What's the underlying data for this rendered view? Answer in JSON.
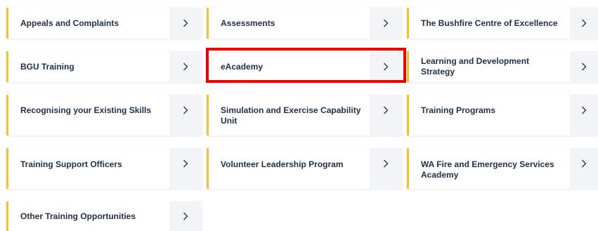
{
  "cards": [
    {
      "label": "Appeals and Complaints",
      "icon": "chevron-right-icon"
    },
    {
      "label": "Assessments",
      "icon": "chevron-right-icon"
    },
    {
      "label": "The Bushfire Centre of Excellence",
      "icon": "chevron-right-icon"
    },
    {
      "label": "BGU Training",
      "icon": "chevron-right-icon"
    },
    {
      "label": "eAcademy",
      "icon": "chevron-right-icon"
    },
    {
      "label": "Learning and Development Strategy",
      "icon": "chevron-right-icon"
    },
    {
      "label": "Recognising your Existing Skills",
      "icon": "chevron-right-icon"
    },
    {
      "label": "Simulation and Exercise Capability Unit",
      "icon": "chevron-right-icon"
    },
    {
      "label": "Training Programs",
      "icon": "chevron-right-icon"
    },
    {
      "label": "Training Support Officers",
      "icon": "chevron-right-icon"
    },
    {
      "label": "Volunteer Leadership Program",
      "icon": "chevron-right-icon"
    },
    {
      "label": "WA Fire and Emergency Services Academy",
      "icon": "chevron-right-icon"
    },
    {
      "label": "Other Training Opportunities",
      "icon": "chevron-right-icon"
    }
  ],
  "colors": {
    "accent": "#f3c231",
    "text": "#1f2f45",
    "arrow_bg": "#f3f4f6",
    "highlight": "#ee0000"
  }
}
